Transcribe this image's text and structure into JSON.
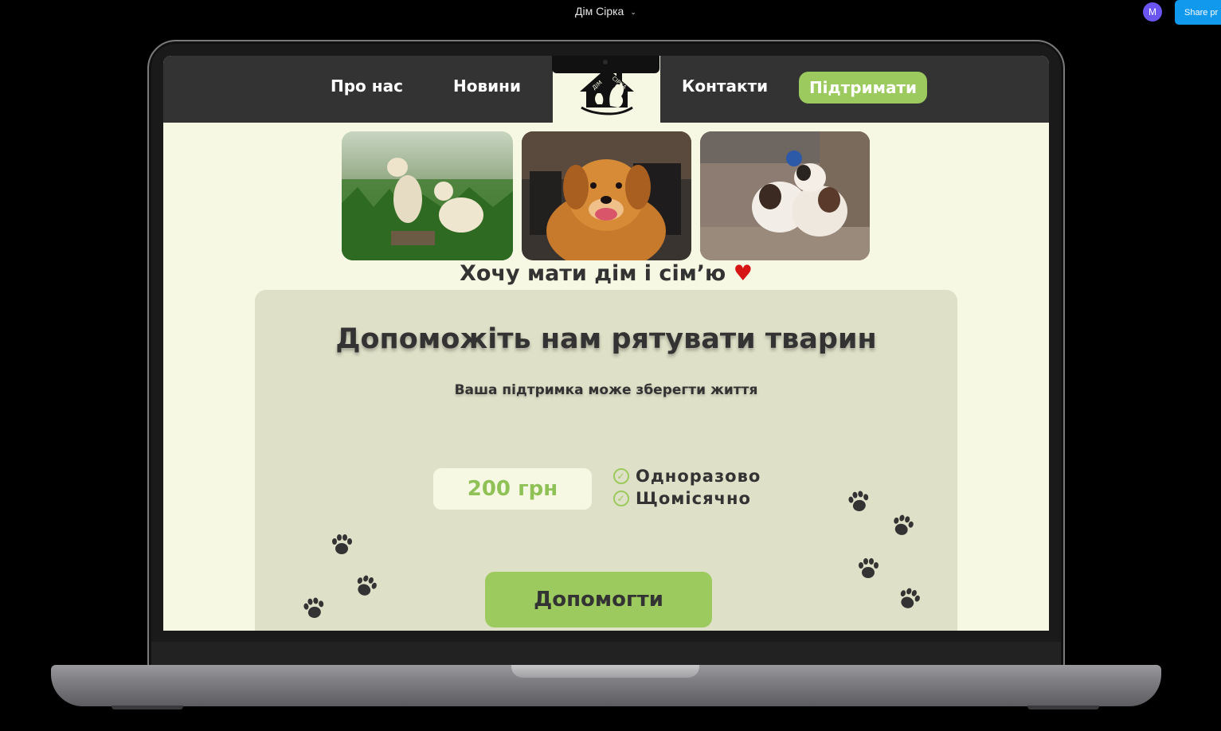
{
  "toolbar": {
    "file_title": "Дім Сірка",
    "avatar_initial": "M",
    "share_label": "Share pr"
  },
  "nav": {
    "items": [
      "Про нас",
      "Новини",
      "Контакти"
    ],
    "support_label": "Підтримати",
    "logo_text": "ДІМ СІРКА"
  },
  "gallery": {
    "photos": [
      "two-labradors-on-grass",
      "golden-retriever-smiling",
      "two-puppies-in-corner"
    ]
  },
  "slogan": {
    "text": "Хочу мати дім і сім’ю",
    "emoji": "♥"
  },
  "donate": {
    "title": "Допоможіть нам рятувати тварин",
    "subtitle": "Ваша підтримка може зберегти життя",
    "amount": "200 грн",
    "options": [
      "Одноразово",
      "Щомісячно"
    ],
    "help_label": "Допомогти"
  },
  "colors": {
    "accent_green": "#9cca5e",
    "background_cream": "#f6f8e3",
    "panel_beige": "#dfe0c8",
    "nav_dark": "#333333"
  }
}
